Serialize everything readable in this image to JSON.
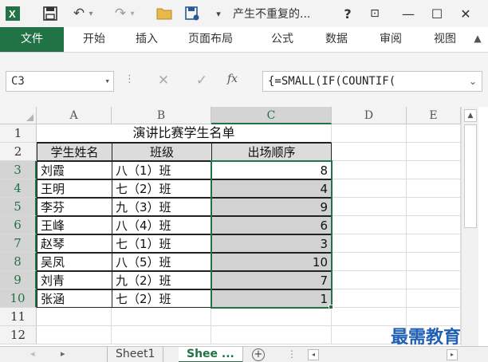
{
  "window": {
    "title": "产生不重复的...",
    "help": "?",
    "ribbon_display": "⊡",
    "minimize": "—",
    "maximize": "☐",
    "close": "✕"
  },
  "qat": {
    "excel_logo": "X",
    "save": "💾",
    "undo": "↶",
    "undo_dd": "▾",
    "redo": "↷",
    "redo_dd": "▾",
    "open": "📂",
    "saveas": "🗎",
    "customize": "▾"
  },
  "ribbon": {
    "tabs": [
      "文件",
      "开始",
      "插入",
      "页面布局",
      "公式",
      "数据",
      "审阅",
      "视图"
    ],
    "collapse": "▲"
  },
  "formula_bar": {
    "name_box": "C3",
    "name_arrow": "▾",
    "separator": "⋮",
    "cancel": "✕",
    "enter": "✓",
    "fx": "fx",
    "formula": "{=SMALL(IF(COUNTIF(",
    "expand": "⌄"
  },
  "grid": {
    "columns": [
      "A",
      "B",
      "C",
      "D",
      "E"
    ],
    "rows": [
      "1",
      "2",
      "3",
      "4",
      "5",
      "6",
      "7",
      "8",
      "9",
      "10",
      "11",
      "12"
    ],
    "title": "演讲比赛学生名单",
    "headers": [
      "学生姓名",
      "班级",
      "出场顺序"
    ],
    "records": [
      {
        "name": "刘霞",
        "class": "八（1）班",
        "order": "8"
      },
      {
        "name": "王明",
        "class": "七（2）班",
        "order": "4"
      },
      {
        "name": "李芬",
        "class": "九（3）班",
        "order": "9"
      },
      {
        "name": "王峰",
        "class": "八（4）班",
        "order": "6"
      },
      {
        "name": "赵琴",
        "class": "七（1）班",
        "order": "3"
      },
      {
        "name": "吴凤",
        "class": "八（5）班",
        "order": "10"
      },
      {
        "name": "刘青",
        "class": "九（2）班",
        "order": "7"
      },
      {
        "name": "张涵",
        "class": "七（2）班",
        "order": "1"
      }
    ],
    "active_cell": "C3"
  },
  "sheets": {
    "tabs": [
      "Sheet1",
      "Shee ..."
    ],
    "prev": "◂",
    "next": "▸",
    "add": "+",
    "separator": "⋮",
    "hscroll_left": "◂",
    "hscroll_right": "▸"
  },
  "watermark": "最需教育",
  "colors": {
    "accent": "#217346",
    "range_fill": "#d2d2d2",
    "watermark": "#1f5fb4"
  }
}
